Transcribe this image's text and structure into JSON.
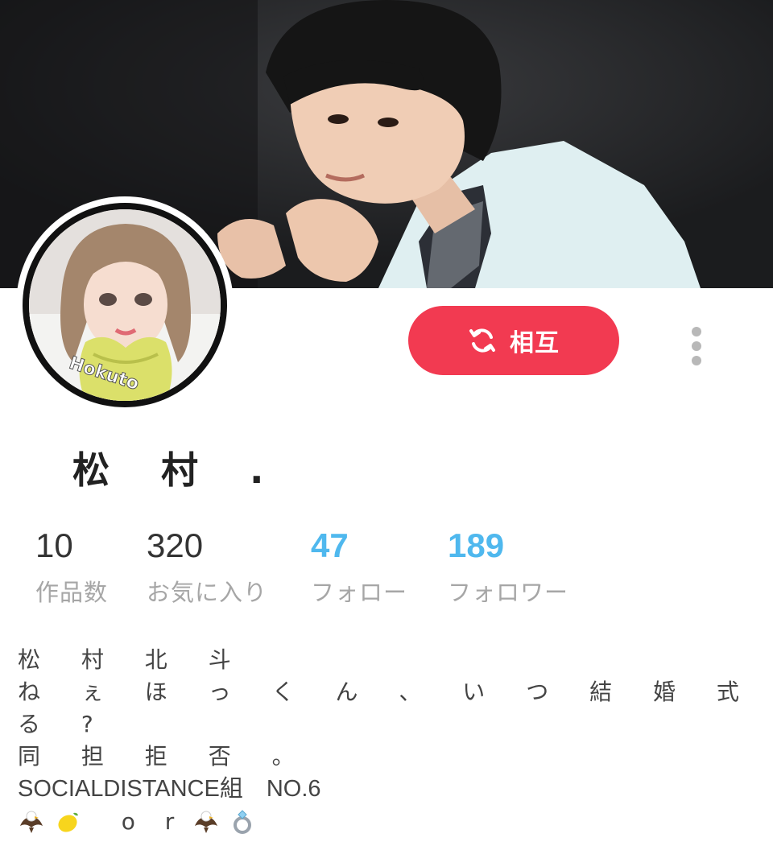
{
  "cover": {
    "description_icon": "cover-photo-icon"
  },
  "avatar": {
    "watermark": "Hokuto",
    "icon": "avatar-photo-icon"
  },
  "actions": {
    "mutual_label": "相互",
    "mutual_icon": "refresh-icon",
    "mutual_color": "#f23a51",
    "more_icon": "more-vertical-icon"
  },
  "profile": {
    "name": "松 村 ."
  },
  "stats": [
    {
      "value": "10",
      "label": "作品数"
    },
    {
      "value": "320",
      "label": "お気に入り"
    },
    {
      "value": "47",
      "label": "フォロー"
    },
    {
      "value": "189",
      "label": "フォロワー"
    }
  ],
  "accent_color": "#4fb8ee",
  "bio": {
    "line1": "松 村 北 斗",
    "line2": "ね ぇ ほ っ く ん 、 い つ 結 婚 式 挙 げ",
    "line3": "る ?",
    "line4": "同 担 拒 否 。",
    "line5": "SOCIALDISTANCE組　NO.6",
    "line6_text": "o r",
    "line6_icons": [
      "eagle-icon",
      "lemon-icon",
      "eagle-icon",
      "ring-icon"
    ]
  }
}
